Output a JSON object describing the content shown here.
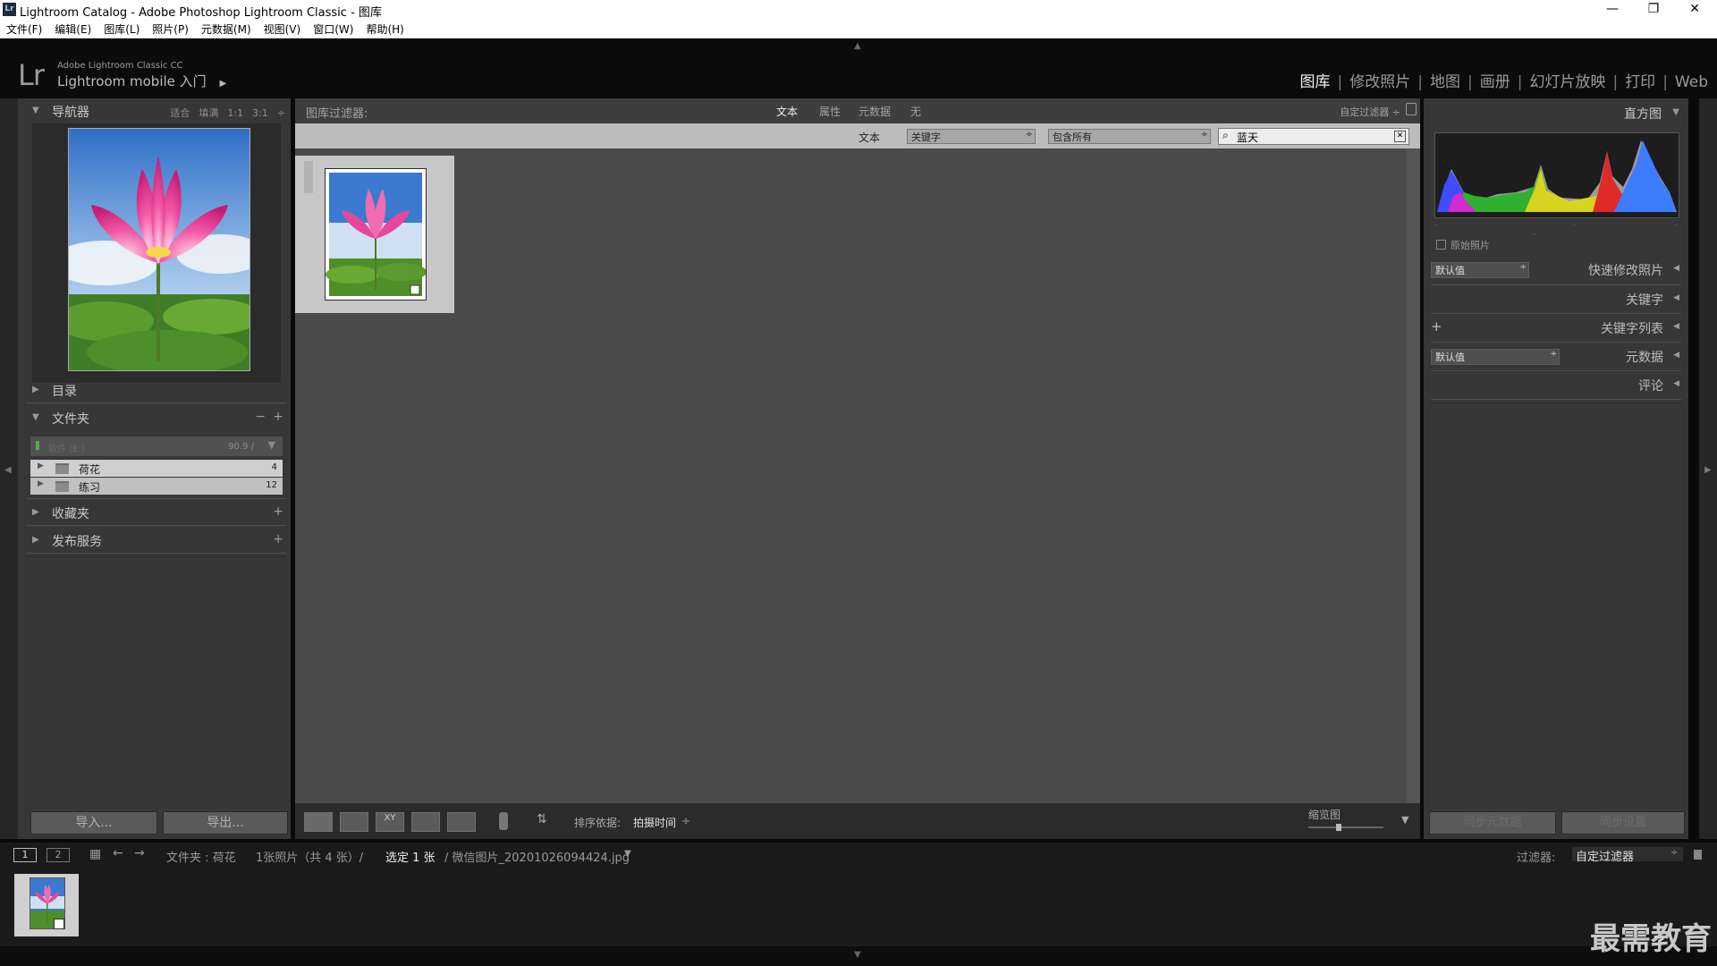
{
  "window": {
    "title": "Lightroom Catalog - Adobe Photoshop Lightroom Classic - 图库",
    "controls": [
      "—",
      "❐",
      "✕"
    ]
  },
  "menu": [
    "文件(F)",
    "编辑(E)",
    "图库(L)",
    "照片(P)",
    "元数据(M)",
    "视图(V)",
    "窗口(W)",
    "帮助(H)"
  ],
  "identity": {
    "logo": "Lr",
    "product": "Adobe Lightroom Classic CC",
    "mobile": "Lightroom mobile 入门",
    "arrow": "▶"
  },
  "modules": [
    "图库",
    "修改照片",
    "地图",
    "画册",
    "幻灯片放映",
    "打印",
    "Web"
  ],
  "left_panel": {
    "navigator": {
      "title": "导航器",
      "options": [
        "适合",
        "填满",
        "1:1",
        "3:1"
      ]
    },
    "catalog": {
      "title": "目录"
    },
    "folders": {
      "title": "文件夹",
      "volume_name": "软件 (E:)",
      "volume_stat": "90.9 /",
      "items": [
        {
          "name": "荷花",
          "count": "4"
        },
        {
          "name": "练习",
          "count": "12"
        }
      ]
    },
    "collections": {
      "title": "收藏夹"
    },
    "publish": {
      "title": "发布服务"
    },
    "import_label": "导入...",
    "export_label": "导出..."
  },
  "filter_bar": {
    "label": "图库过滤器:",
    "tabs": [
      "文本",
      "属性",
      "元数据",
      "无"
    ],
    "custom": "自定过滤器 ÷",
    "row_label": "文本",
    "field": "关键字",
    "rule": "包含所有",
    "search_value": "蓝天"
  },
  "toolbar": {
    "sort_label": "排序依据:",
    "sort_value": "拍摄时间",
    "thumb_label": "缩览图",
    "thumb_level": 0.4
  },
  "right_panel": {
    "histogram": {
      "title": "直方图"
    },
    "original_photo": "原始照片",
    "quick_develop": {
      "title": "快速修改照片",
      "preset": "默认值"
    },
    "keywording": {
      "title": "关键字"
    },
    "keyword_list": {
      "title": "关键字列表"
    },
    "metadata": {
      "title": "元数据",
      "preset": "默认值"
    },
    "comments": {
      "title": "评论"
    },
    "sync_metadata": "同步元数据",
    "sync_settings": "同步设置"
  },
  "filmstrip": {
    "pages": [
      "1",
      "2"
    ],
    "source": "文件夹 : 荷花",
    "count_text": "1张照片（共 4 张）/",
    "selected_text": "选定 1 张",
    "filename": "/ 微信图片_20201026094424.jpg",
    "filter_label": "过滤器:",
    "filter_value": "自定过滤器"
  },
  "watermark": "最需教育",
  "colors": {
    "panel": "#373737",
    "grid": "#4a4a4a",
    "accent": "#f0f0f0"
  }
}
